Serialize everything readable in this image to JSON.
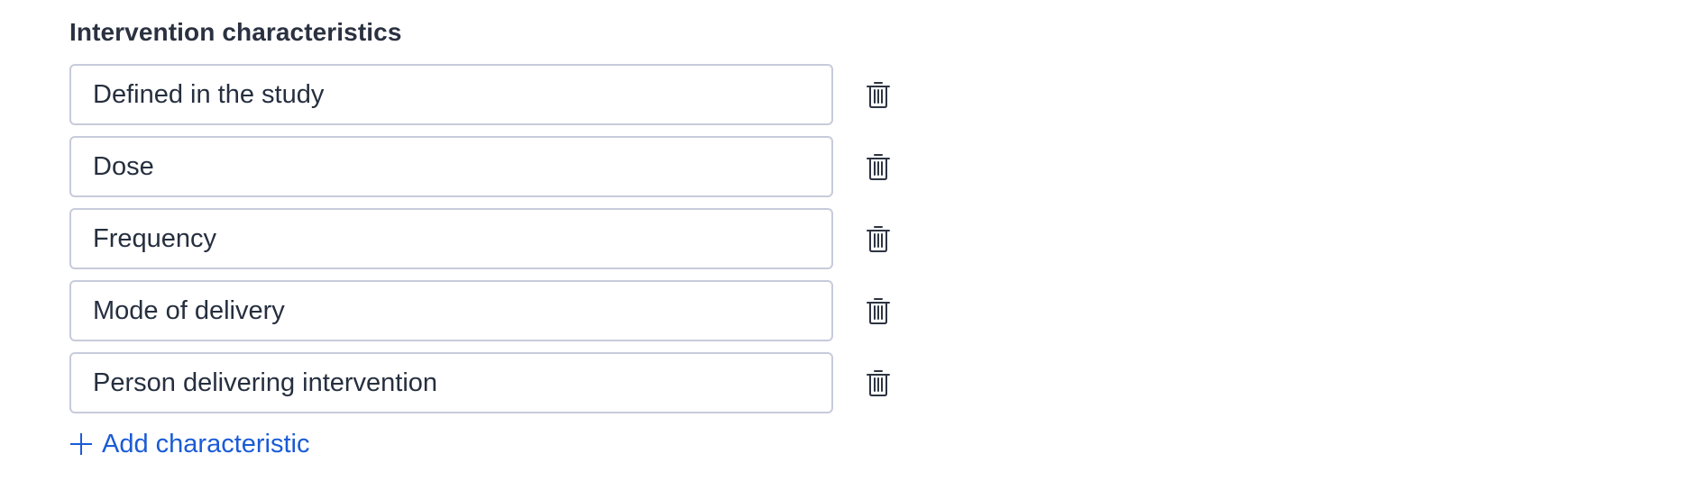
{
  "section": {
    "title": "Intervention characteristics"
  },
  "characteristics": [
    {
      "value": "Defined in the study",
      "delete_icon": "trash-icon"
    },
    {
      "value": "Dose",
      "delete_icon": "trash-icon"
    },
    {
      "value": "Frequency",
      "delete_icon": "trash-icon"
    },
    {
      "value": "Mode of delivery",
      "delete_icon": "trash-icon"
    },
    {
      "value": "Person delivering intervention",
      "delete_icon": "trash-icon"
    }
  ],
  "add_button": {
    "label": "Add characteristic",
    "icon": "plus-icon"
  },
  "colors": {
    "link": "#1a5bd6",
    "field_border": "#c7cbdb",
    "text": "#262f3f",
    "icon": "#2d3442"
  }
}
